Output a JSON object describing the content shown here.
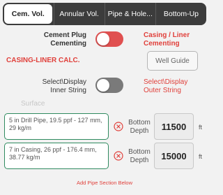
{
  "tabs": [
    {
      "label": "Cem. Vol.",
      "active": true
    },
    {
      "label": "Annular Vol.",
      "active": false
    },
    {
      "label": "Pipe & Hole...",
      "active": false
    },
    {
      "label": "Bottom-Up",
      "active": false
    }
  ],
  "mode_row": {
    "left_label_line1": "Cement Plug",
    "left_label_line2": "Cementing",
    "right_label_line1": "Casing / Liner",
    "right_label_line2": "Cementing",
    "toggle_on": true
  },
  "calc_title": "CASING-LINER CALC.",
  "well_guide_label": "Well Guide",
  "string_row": {
    "left_label_line1": "Select\\Display",
    "left_label_line2": "Inner String",
    "right_label_line1": "Select\\Display",
    "right_label_line2": "Outer String",
    "toggle_on": false
  },
  "surface_label": "Surface",
  "pipe_sections": [
    {
      "description": "5 in Drill Pipe, 19.5 ppf - 127 mm, 29 kg/m",
      "depth_label_line1": "Bottom",
      "depth_label_line2": "Depth",
      "depth_value": "11500",
      "unit": "ft"
    },
    {
      "description": "7 in Casing, 26 ppf - 176.4 mm, 38.77 kg/m",
      "depth_label_line1": "Bottom",
      "depth_label_line2": "Depth",
      "depth_value": "15000",
      "unit": "ft"
    }
  ],
  "add_pipe_label": "Add Pipe Section Below",
  "colors": {
    "accent_red": "#e0403b",
    "toggle_on": "#e05050",
    "toggle_off": "#7a7a7a",
    "pipe_border": "#2f8a5f",
    "tab_bar": "#3c3c3c"
  }
}
